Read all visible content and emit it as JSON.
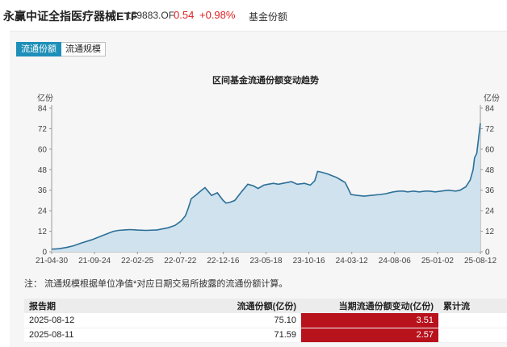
{
  "header": {
    "fund_name": "永赢中证全指医疗器械ETF",
    "code": "159883.OF",
    "price": "0.54",
    "change": "+0.98%",
    "section": "基金份额"
  },
  "tabs": [
    {
      "label": "流通份额",
      "active": true
    },
    {
      "label": "流通规模",
      "active": false
    }
  ],
  "chart_data": {
    "type": "area",
    "title": "区间基金流通份额变动趋势",
    "ylabel_left": "亿份",
    "ylabel_right": "亿份",
    "ylim": [
      0,
      84
    ],
    "yticks": [
      0,
      12,
      24,
      36,
      48,
      60,
      72,
      84
    ],
    "xtick_labels": [
      "21-04-30",
      "21-09-24",
      "22-02-25",
      "22-07-22",
      "22-12-16",
      "23-05-18",
      "23-10-16",
      "24-03-12",
      "24-08-06",
      "25-01-02",
      "25-08-12"
    ],
    "grid": false,
    "line_color": "#2c6f98",
    "fill_color": "#cfe2ed",
    "series": [
      {
        "x": [
          0,
          10,
          20,
          30,
          40,
          55,
          70,
          85,
          92,
          100,
          108,
          118,
          130,
          145,
          160,
          170,
          178,
          184,
          188,
          192,
          198,
          205,
          211,
          216,
          220,
          228,
          236,
          240,
          246,
          252,
          262,
          270,
          278,
          284,
          288,
          292,
          298,
          305,
          312,
          318,
          324,
          330,
          338,
          348,
          356,
          362,
          366,
          372,
          380,
          386,
          392,
          398,
          404,
          412,
          420,
          430,
          440,
          452,
          460,
          470,
          478,
          484,
          490,
          498,
          506,
          514,
          520,
          528,
          536,
          546,
          556,
          562,
          570,
          576,
          580,
          582,
          585,
          588,
          590
        ],
        "values": [
          1.5,
          1.8,
          2.5,
          3.5,
          5.0,
          7.0,
          9.5,
          12.0,
          12.5,
          12.8,
          13.0,
          12.7,
          12.5,
          12.8,
          14.0,
          15.5,
          18.0,
          21.0,
          25.5,
          31.0,
          33.0,
          35.5,
          37.5,
          35.0,
          33.0,
          34.5,
          30.0,
          28.5,
          29.0,
          30.0,
          35.5,
          39.5,
          38.5,
          37.0,
          38.0,
          39.0,
          39.5,
          40.0,
          39.5,
          40.0,
          40.5,
          41.0,
          39.5,
          40.0,
          39.0,
          41.5,
          47.0,
          46.5,
          45.5,
          44.5,
          43.5,
          42.0,
          40.5,
          33.5,
          33.0,
          32.5,
          33.0,
          33.5,
          34.0,
          35.0,
          35.5,
          35.5,
          35.0,
          35.5,
          35.0,
          35.5,
          35.5,
          35.0,
          35.5,
          36.0,
          35.5,
          36.0,
          38.0,
          42.0,
          48.0,
          55.0,
          57.5,
          68.0,
          75.1
        ]
      }
    ]
  },
  "note": "注：  流通规模根据单位净值*对应日期交易所披露的流通份额计算。",
  "table": {
    "headers": [
      "报告期",
      "流通份额(亿份)",
      "当期流通份额变动(亿份)",
      "累计流"
    ],
    "rows": [
      {
        "date": "2025-08-12",
        "shares": "75.10",
        "change": "3.51"
      },
      {
        "date": "2025-08-11",
        "shares": "71.59",
        "change": "2.57"
      }
    ]
  }
}
